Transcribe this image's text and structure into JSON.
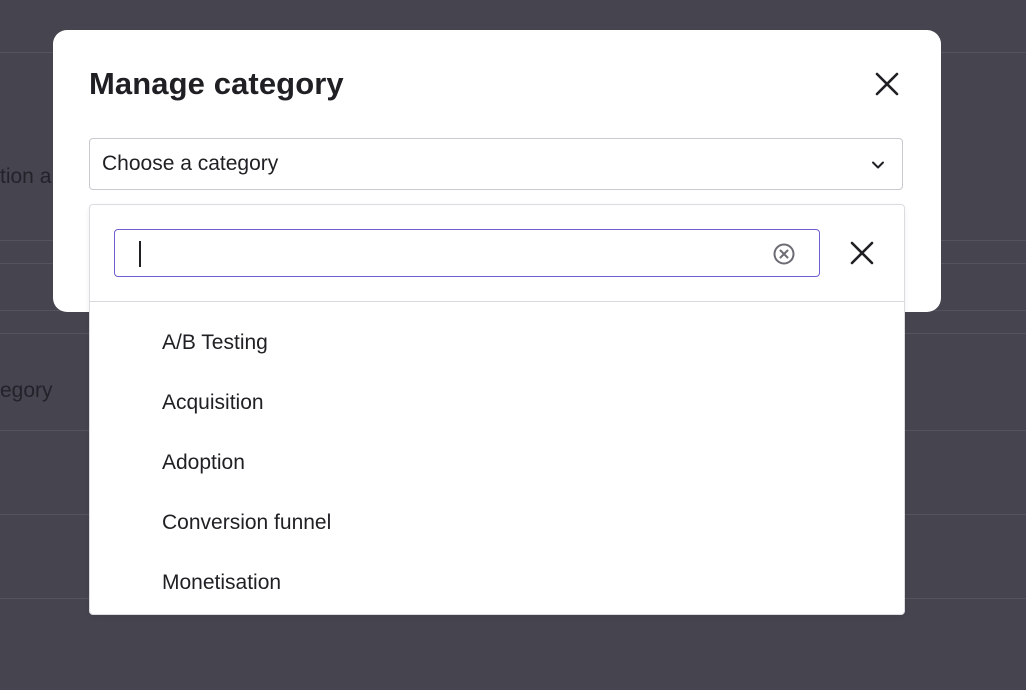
{
  "background": {
    "partial_text_1": "tion a",
    "partial_text_2": "egory"
  },
  "modal": {
    "title": "Manage category",
    "close_icon": "close-icon",
    "select": {
      "placeholder": "Choose a category",
      "chevron_icon": "chevron-down-icon"
    }
  },
  "dropdown": {
    "search": {
      "value": "",
      "clear_icon": "clear-circle-icon"
    },
    "close_icon": "close-icon",
    "options": [
      {
        "label": "A/B Testing"
      },
      {
        "label": "Acquisition"
      },
      {
        "label": "Adoption"
      },
      {
        "label": "Conversion funnel"
      },
      {
        "label": "Monetisation"
      }
    ]
  },
  "colors": {
    "overlay": "#45444f",
    "focus_border": "#6b5fd1",
    "text": "#1f1f24"
  }
}
